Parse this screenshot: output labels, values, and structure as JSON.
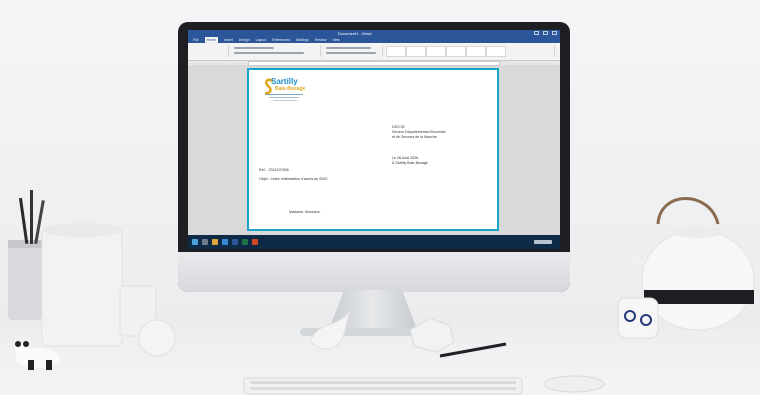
{
  "app": {
    "window_title": "Document1 - Word"
  },
  "ribbon_tabs": [
    "File",
    "Home",
    "Insert",
    "Design",
    "Layout",
    "References",
    "Mailings",
    "Review",
    "View"
  ],
  "letter": {
    "logo_name": "Sartilly",
    "logo_sub": "Baie-Bocage",
    "recipient_line1": "DDS 50",
    "recipient_line2": "Service Départemental d'Incendie",
    "recipient_line3": "et de Secours de la Manche",
    "date_line1": "Le 26 Août 2026,",
    "date_line2": "À Sartilly Baie-Bocage",
    "ref": "Réf. : 2021/07/008",
    "object": "Objet : Lettre d'attestation d'accès au SDIS",
    "salutation": "Madame, Monsieur,"
  },
  "colors": {
    "word_blue": "#2b579a",
    "page_border": "#1aa3c8",
    "taskbar": "#0f2a46"
  }
}
